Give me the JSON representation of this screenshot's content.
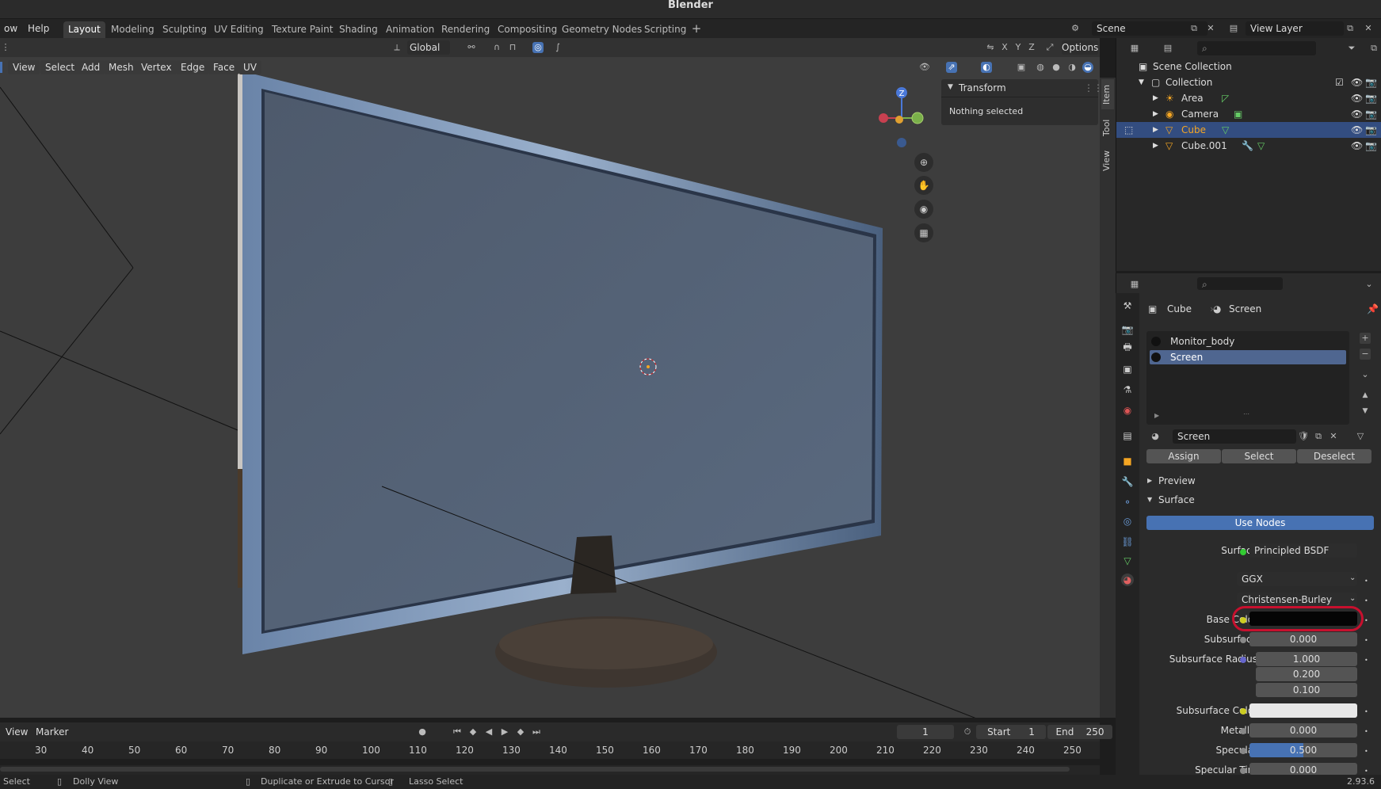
{
  "app": {
    "title": "Blender",
    "version": "2.93.6"
  },
  "menus": [
    "ow",
    "Help"
  ],
  "workspaces": [
    "Layout",
    "Modeling",
    "Sculpting",
    "UV Editing",
    "Texture Paint",
    "Shading",
    "Animation",
    "Rendering",
    "Compositing",
    "Geometry Nodes",
    "Scripting"
  ],
  "active_workspace": "Layout",
  "scene": {
    "name": "Scene",
    "view_layer": "View Layer"
  },
  "viewport_header": {
    "transform_orientation": "Global",
    "axes": [
      "X",
      "Y",
      "Z"
    ],
    "options": "Options",
    "menus": [
      "View",
      "Select",
      "Add",
      "Mesh",
      "Vertex",
      "Edge",
      "Face",
      "UV"
    ]
  },
  "npanel": {
    "tabs": [
      "Item",
      "Tool",
      "View"
    ],
    "transform_title": "Transform",
    "transform_message": "Nothing selected"
  },
  "gizmo": {
    "z": "Z"
  },
  "outliner": {
    "scene_collection": "Scene Collection",
    "collection": "Collection",
    "items": [
      {
        "name": "Area",
        "selected": false
      },
      {
        "name": "Camera",
        "selected": false
      },
      {
        "name": "Cube",
        "selected": true
      },
      {
        "name": "Cube.001",
        "selected": false
      }
    ]
  },
  "properties": {
    "breadcrumb_object": "Cube",
    "breadcrumb_material": "Screen",
    "material_slots": [
      "Monitor_body",
      "Screen"
    ],
    "active_slot": "Screen",
    "material_name": "Screen",
    "slot_buttons": {
      "assign": "Assign",
      "select": "Select",
      "deselect": "Deselect"
    },
    "panels": {
      "preview": "Preview",
      "surface": "Surface"
    },
    "use_nodes": "Use Nodes",
    "surface": {
      "label": "Surface",
      "value": "Principled BSDF"
    },
    "distribution": "GGX",
    "subsurface_method": "Christensen-Burley",
    "fields": {
      "base_color": {
        "label": "Base Color",
        "color": "#050505"
      },
      "subsurface": {
        "label": "Subsurface",
        "value": "0.000"
      },
      "subsurface_radius": {
        "label": "Subsurface Radius",
        "values": [
          "1.000",
          "0.200",
          "0.100"
        ]
      },
      "subsurface_color": {
        "label": "Subsurface Color",
        "color": "#e8e8e8"
      },
      "metallic": {
        "label": "Metallic",
        "value": "0.000"
      },
      "specular": {
        "label": "Specular",
        "value": "0.500",
        "fill": 0.5
      },
      "specular_tint": {
        "label": "Specular Tint",
        "value": "0.000"
      }
    }
  },
  "timeline": {
    "menus": [
      "View",
      "Marker"
    ],
    "current_frame": "1",
    "start_label": "Start",
    "start": "1",
    "end_label": "End",
    "end": "250",
    "ticks": [
      "30",
      "40",
      "50",
      "60",
      "70",
      "80",
      "90",
      "100",
      "110",
      "120",
      "130",
      "140",
      "150",
      "160",
      "170",
      "180",
      "190",
      "200",
      "210",
      "220",
      "230",
      "240",
      "250"
    ]
  },
  "statusbar": {
    "select": "Select",
    "dolly": "Dolly View",
    "duplicate": "Duplicate or Extrude to Cursor",
    "lasso": "Lasso Select",
    "version": "2.93.6"
  },
  "colors": {
    "accent": "#4772b3",
    "selected_row": "#334d80",
    "highlight_ring": "#c8102e",
    "active_object": "#f5a623"
  }
}
